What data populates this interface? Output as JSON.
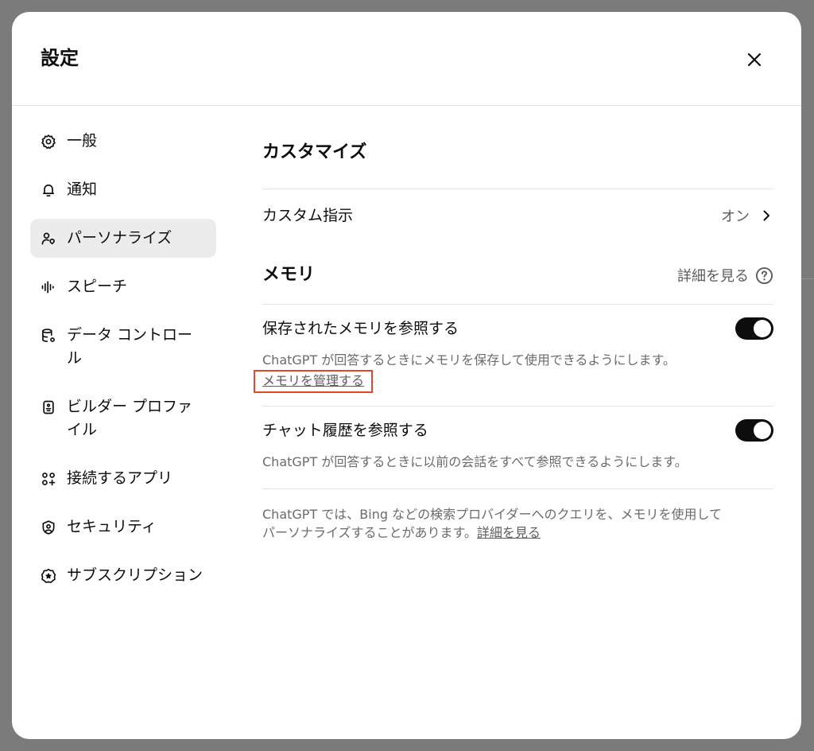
{
  "modal": {
    "title": "設定",
    "close_icon": "close-icon"
  },
  "sidebar": {
    "items": [
      {
        "label": "一般",
        "icon": "gear-icon"
      },
      {
        "label": "通知",
        "icon": "bell-icon"
      },
      {
        "label": "パーソナライズ",
        "icon": "personalize-icon",
        "active": true
      },
      {
        "label": "スピーチ",
        "icon": "waveform-icon"
      },
      {
        "label": "データ コントロール",
        "icon": "database-gear-icon"
      },
      {
        "label": "ビルダー プロファイル",
        "icon": "id-badge-icon"
      },
      {
        "label": "接続するアプリ",
        "icon": "apps-grid-icon"
      },
      {
        "label": "セキュリティ",
        "icon": "shield-user-icon"
      },
      {
        "label": "サブスクリプション",
        "icon": "badge-star-icon"
      }
    ]
  },
  "main": {
    "customize": {
      "title": "カスタマイズ",
      "custom_instructions_label": "カスタム指示",
      "custom_instructions_value": "オン"
    },
    "memory": {
      "title": "メモリ",
      "learn_more_label": "詳細を見る",
      "saved_memory_label": "保存されたメモリを参照する",
      "saved_memory_on": true,
      "saved_memory_desc": "ChatGPT が回答するときにメモリを保存して使用できるようにします。",
      "manage_memory_link": "メモリを管理する",
      "chat_history_label": "チャット履歴を参照する",
      "chat_history_on": true,
      "chat_history_desc": "ChatGPT が回答するときに以前の会話をすべて参照できるようにします。",
      "footer_text": "ChatGPT では、Bing などの検索プロバイダーへのクエリを、メモリを使用してパーソナライズすることがあります。",
      "footer_link": "詳細を見る"
    }
  },
  "colors": {
    "toggle_on": "#0d0d0d",
    "highlight_border": "#e0472c",
    "active_item_bg": "#ececec"
  }
}
